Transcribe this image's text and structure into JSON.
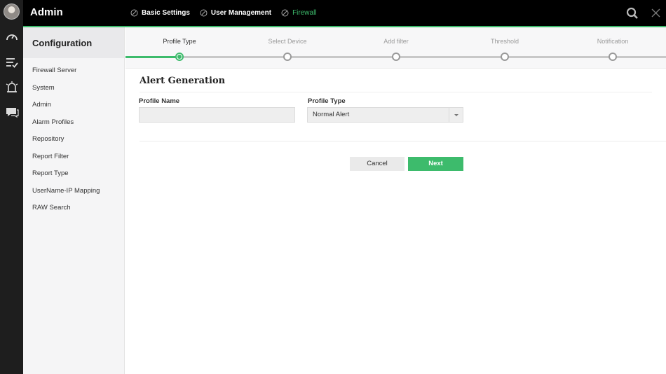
{
  "app": {
    "title": "Admin"
  },
  "breadcrumbs": [
    {
      "label": "Basic Settings",
      "icon": "check-circle-icon"
    },
    {
      "label": "User Management",
      "icon": "check-circle-icon"
    },
    {
      "label": "Firewall",
      "icon": "check-circle-icon",
      "active": true
    }
  ],
  "rail": {
    "items": [
      "avatar",
      "dashboard-icon",
      "checklist-icon",
      "alarm-icon",
      "chat-icon"
    ]
  },
  "sidebar": {
    "title": "Configuration",
    "items": [
      {
        "label": "Firewall Server"
      },
      {
        "label": "System"
      },
      {
        "label": "Admin"
      },
      {
        "label": "Alarm Profiles"
      },
      {
        "label": "Repository"
      },
      {
        "label": "Report Filter"
      },
      {
        "label": "Report Type"
      },
      {
        "label": "UserName-IP Mapping"
      },
      {
        "label": "RAW Search"
      }
    ]
  },
  "wizard": {
    "steps": [
      {
        "label": "Profile Type",
        "active": true
      },
      {
        "label": "Select Device"
      },
      {
        "label": "Add filter"
      },
      {
        "label": "Threshold"
      },
      {
        "label": "Notification"
      }
    ]
  },
  "form": {
    "title": "Alert Generation",
    "profile_name": {
      "label": "Profile Name",
      "value": ""
    },
    "profile_type": {
      "label": "Profile Type",
      "value": "Normal Alert"
    }
  },
  "actions": {
    "cancel": "Cancel",
    "next": "Next"
  },
  "colors": {
    "accent": "#3dbb6c",
    "topbar": "#000000",
    "rail": "#1e1e1e"
  }
}
